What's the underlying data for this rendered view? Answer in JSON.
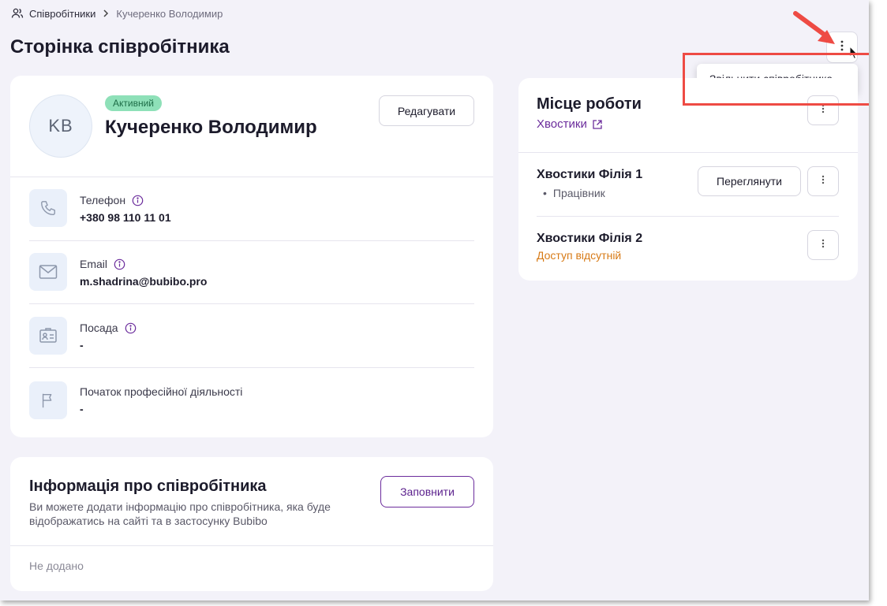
{
  "breadcrumb": {
    "root": "Співробітники",
    "current": "Кучеренко Володимир"
  },
  "page": {
    "title": "Сторінка співробітника"
  },
  "menu": {
    "dismiss_label": "Звільнити співробітника"
  },
  "profile": {
    "initials": "KB",
    "status": "Активний",
    "name": "Кучеренко Володимир",
    "edit_label": "Редагувати",
    "fields": [
      {
        "label": "Телефон",
        "value": "+380 98 110 11 01",
        "icon": "phone-icon"
      },
      {
        "label": "Email",
        "value": "m.shadrina@bubibo.pro",
        "icon": "mail-icon"
      },
      {
        "label": "Посада",
        "value": "-",
        "icon": "id-badge-icon"
      },
      {
        "label": "Початок професійної діяльності",
        "value": "-",
        "icon": "flag-icon"
      }
    ]
  },
  "info": {
    "title": "Інформація про співробітника",
    "description": "Ви можете додати інформацію про співробітника, яка буде відображатись на сайті та в застосунку Bubibo",
    "fill_label": "Заповнити",
    "empty_text": "Не додано"
  },
  "work": {
    "title": "Місце роботи",
    "company": "Хвостики",
    "branches": [
      {
        "name": "Хвостики Філія 1",
        "role": "Працівник",
        "view_label": "Переглянути"
      },
      {
        "name": "Хвостики Філія 2",
        "status": "Доступ відсутній"
      }
    ]
  },
  "colors": {
    "accent": "#6b2c9c",
    "active_badge": "#8ee0b8",
    "warning": "#d77a16",
    "annotation": "#ee4b44"
  }
}
